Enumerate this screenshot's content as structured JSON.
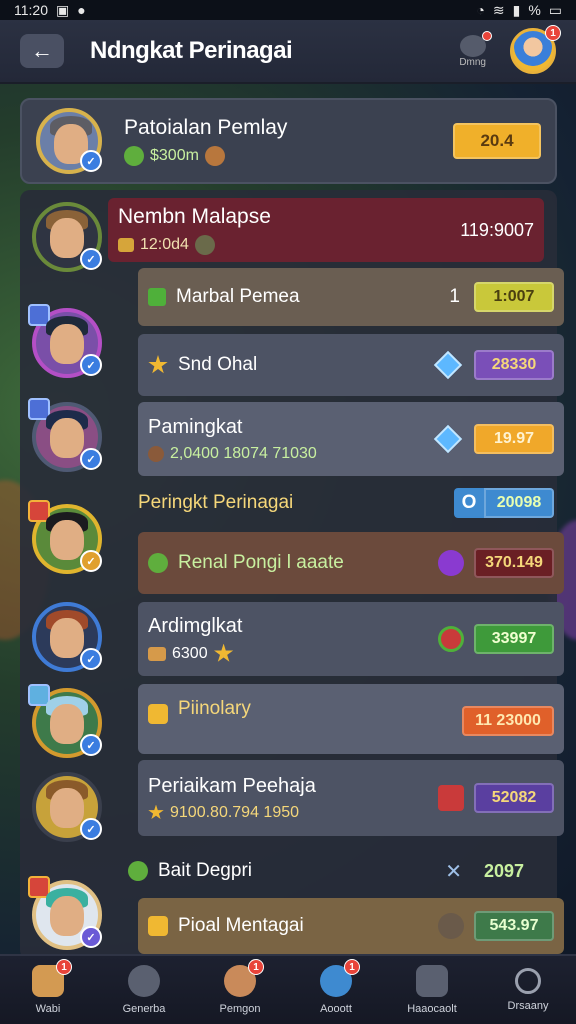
{
  "status_bar": {
    "time": "11:20",
    "battery": "%"
  },
  "header": {
    "back_label": "←",
    "title": "Ndngkat Perinagai",
    "aux_button_label": "Dmng",
    "profile_badge": "1"
  },
  "top_player": {
    "name": "Patoialan Pemlay",
    "coins": "$300m",
    "value": "20.4"
  },
  "rows": [
    {
      "name": "Nembn Malapse",
      "sub": "12:0d4",
      "value": "119:9007"
    },
    {
      "name": "Marbal Pemea",
      "prefix": "1",
      "value": "1:007"
    },
    {
      "name": "Snd Ohal",
      "value": "28330"
    },
    {
      "name": "Pamingkat",
      "sub": "2,0400 18074 71030",
      "value": "19.97"
    },
    {
      "name": "Peringkt Perinagai",
      "value": "20098"
    },
    {
      "name": "Renal Pongi l aaate",
      "value": "370.149"
    },
    {
      "name": "Ardimglkat",
      "sub": "6300",
      "value": "33997"
    },
    {
      "name": "Piinolary",
      "value": "11 23000"
    },
    {
      "name": "Periaikam Peehaja",
      "sub": "9100.80.794 1950",
      "value": "52082"
    },
    {
      "name": "Bait Degpri",
      "value": "2097"
    },
    {
      "name": "Pioal Mentagai",
      "value": "543.97"
    }
  ],
  "nav": [
    {
      "label": "Wabi",
      "badge": "1"
    },
    {
      "label": "Generba"
    },
    {
      "label": "Pemgon",
      "badge": "1"
    },
    {
      "label": "Aooott",
      "badge": "1"
    },
    {
      "label": "Haaocaolt"
    },
    {
      "label": "Drsaany"
    }
  ]
}
